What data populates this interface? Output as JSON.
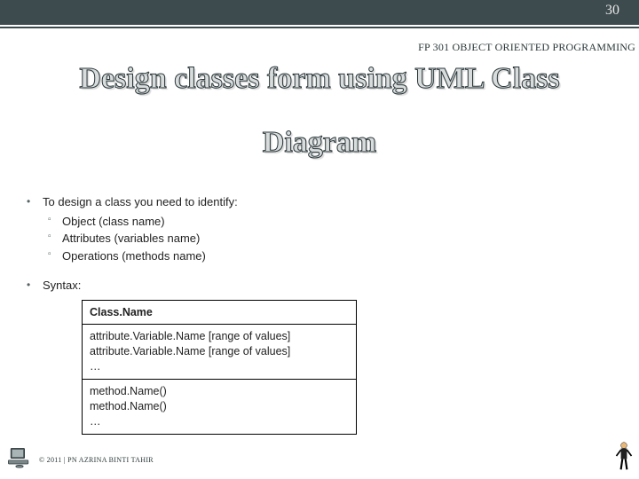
{
  "page_number": "30",
  "course": "FP 301 OBJECT ORIENTED PROGRAMMING",
  "title_line1": "Design classes form using UML Class",
  "title_line2": "Diagram",
  "intro": "To design a class you need to identify:",
  "sub": {
    "a": "Object (class name)",
    "b": "Attributes (variables name)",
    "c": "Operations (methods name)"
  },
  "syntax_label": "Syntax:",
  "uml": {
    "class_name": "Class.Name",
    "attrs_line1": "attribute.Variable.Name [range of values]",
    "attrs_line2": "attribute.Variable.Name [range of values]",
    "attrs_ell": "…",
    "meth_line1": "method.Name()",
    "meth_line2": "method.Name()",
    "meth_ell": "…"
  },
  "copyright": "© 2011 | PN AZRINA BINTI TAHIR"
}
